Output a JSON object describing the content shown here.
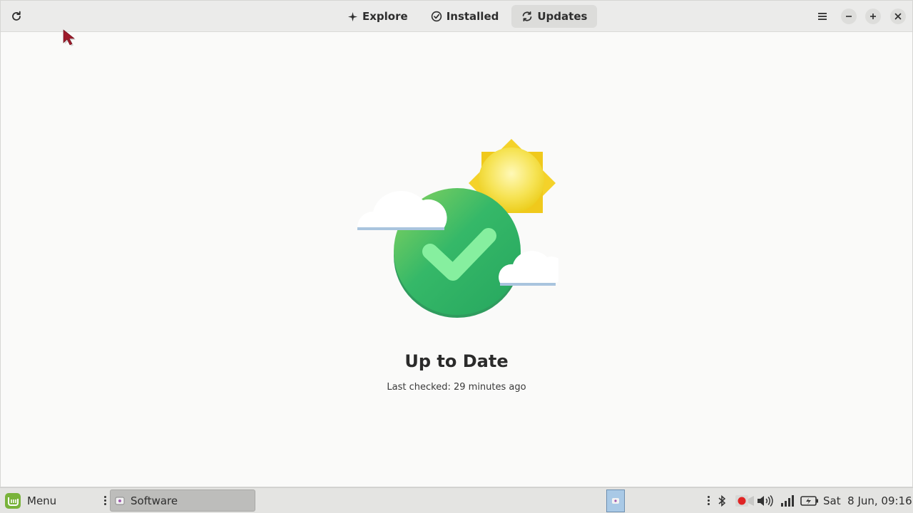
{
  "header": {
    "tabs": [
      {
        "label": "Explore",
        "icon": "explore-icon"
      },
      {
        "label": "Installed",
        "icon": "installed-check-icon"
      },
      {
        "label": "Updates",
        "icon": "refresh-icon"
      }
    ],
    "active_tab": "Updates"
  },
  "main": {
    "title": "Up to Date",
    "subtitle": "Last checked: 29 minutes ago"
  },
  "taskbar": {
    "menu_label": "Menu",
    "window_label": "Software",
    "clock": "Sat  8 Jun, 09:16"
  },
  "colors": {
    "green_circle": "#2fb36a",
    "checkmark": "#7ee89b",
    "sun": "#f1d21f",
    "mint_logo": "#79b33b"
  }
}
